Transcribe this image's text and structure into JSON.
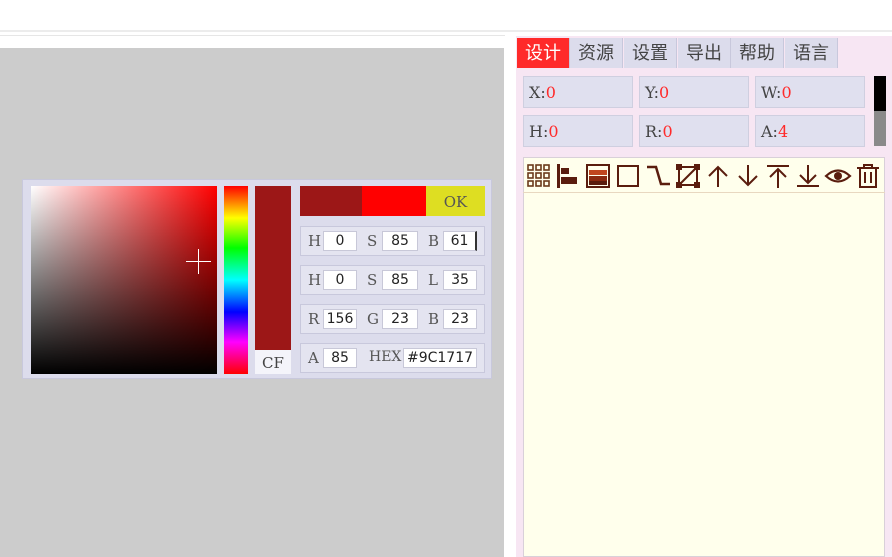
{
  "picker": {
    "side_label": "CF",
    "ok_label": "OK",
    "hsb": {
      "h_label": "H",
      "h": "0",
      "s_label": "S",
      "s": "85",
      "b_label": "B",
      "b": "61"
    },
    "hsl": {
      "h_label": "H",
      "h": "0",
      "s_label": "S",
      "s": "85",
      "l_label": "L",
      "l": "35"
    },
    "rgb": {
      "r_label": "R",
      "r": "156",
      "g_label": "G",
      "g": "23",
      "b_label": "B",
      "b": "23"
    },
    "alpha": {
      "a_label": "A",
      "a": "85",
      "hex_label": "HEX",
      "hex": "#9C1717"
    },
    "colors": {
      "current": "#9C1717",
      "new": "#FF0000",
      "ok": "#DEDE22"
    }
  },
  "tabs": [
    "设计",
    "资源",
    "设置",
    "导出",
    "帮助",
    "语言"
  ],
  "active_tab": "设计",
  "props": {
    "x_label": "X:",
    "x": "0",
    "y_label": "Y:",
    "y": "0",
    "w_label": "W:",
    "w": "0",
    "h_label": "H:",
    "h": "0",
    "r_label": "R:",
    "r": "0",
    "a_label": "A:",
    "a": "4"
  },
  "toolbar_icons": [
    "grid-icon",
    "align-left-icon",
    "layers-icon",
    "rectangle-icon",
    "connector-icon",
    "transform-icon",
    "arrow-up-icon",
    "arrow-down-icon",
    "bring-top-icon",
    "send-bottom-icon",
    "eye-icon",
    "trash-icon"
  ],
  "accent_color": "#FF2A2A"
}
